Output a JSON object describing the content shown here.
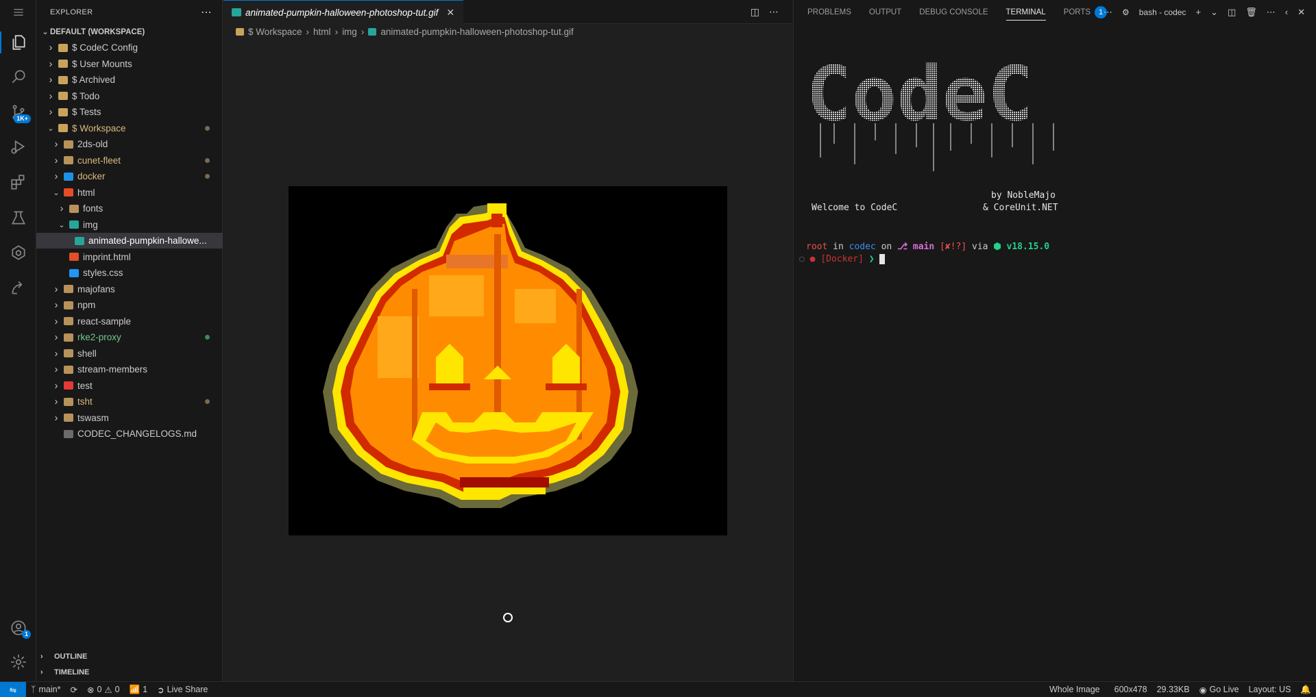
{
  "explorer": {
    "title": "EXPLORER",
    "workspace": "DEFAULT (WORKSPACE)",
    "items": [
      {
        "label": "$ CodeC Config",
        "color": "#cccccc"
      },
      {
        "label": "$ User Mounts",
        "color": "#cccccc"
      },
      {
        "label": "$ Archived",
        "color": "#cccccc"
      },
      {
        "label": "$ Todo",
        "color": "#cccccc"
      },
      {
        "label": "$ Tests",
        "color": "#cccccc"
      },
      {
        "label": "$ Workspace",
        "color": "#d7ba7d"
      },
      {
        "label": "2ds-old",
        "color": "#cccccc"
      },
      {
        "label": "cunet-fleet",
        "color": "#d7ba7d"
      },
      {
        "label": "docker",
        "color": "#d7ba7d"
      },
      {
        "label": "html",
        "color": "#cccccc"
      },
      {
        "label": "fonts",
        "color": "#cccccc"
      },
      {
        "label": "img",
        "color": "#cccccc"
      },
      {
        "label": "animated-pumpkin-hallowe...",
        "color": "#ffffff"
      },
      {
        "label": "imprint.html",
        "color": "#cccccc"
      },
      {
        "label": "styles.css",
        "color": "#cccccc"
      },
      {
        "label": "majofans",
        "color": "#cccccc"
      },
      {
        "label": "npm",
        "color": "#cccccc"
      },
      {
        "label": "react-sample",
        "color": "#cccccc"
      },
      {
        "label": "rke2-proxy",
        "color": "#73c991"
      },
      {
        "label": "shell",
        "color": "#cccccc"
      },
      {
        "label": "stream-members",
        "color": "#cccccc"
      },
      {
        "label": "test",
        "color": "#cccccc"
      },
      {
        "label": "tsht",
        "color": "#d7ba7d"
      },
      {
        "label": "tswasm",
        "color": "#cccccc"
      },
      {
        "label": "CODEC_CHANGELOGS.md",
        "color": "#cccccc"
      }
    ],
    "outline": "OUTLINE",
    "timeline": "TIMELINE"
  },
  "activity_badges": {
    "source_control": "1K+",
    "accounts": "1"
  },
  "editor": {
    "tab_label": "animated-pumpkin-halloween-photoshop-tut.gif",
    "breadcrumb": [
      "$ Workspace",
      "html",
      "img",
      "animated-pumpkin-halloween-photoshop-tut.gif"
    ]
  },
  "panel": {
    "tabs": [
      "PROBLEMS",
      "OUTPUT",
      "DEBUG CONSOLE",
      "TERMINAL",
      "PORTS"
    ],
    "ports_badge": "1",
    "terminal_name": "bash - codec",
    "logo_text": "CodeC",
    "welcome": "Welcome to CodeC",
    "by_line1": "by NobleMajo",
    "by_line2": "& CoreUnit.NET",
    "prompt": {
      "user": "root",
      "in": " in ",
      "host": "codec",
      "on": " on ",
      "branch": "⎇ main",
      "status": " [✘!?]",
      "via": " via ",
      "node": "⬢ v18.15.0"
    },
    "prompt2": "[Docker]",
    "prompt_arrow": "❯"
  },
  "statusbar": {
    "branch": "main*",
    "errors": "0",
    "warnings": "0",
    "ports": "1",
    "live_share": "Live Share",
    "whole_image": "Whole Image",
    "dimensions": "600x478",
    "size": "29.33KB",
    "go_live": "Go Live",
    "layout": "Layout: US"
  },
  "colors": {
    "accent": "#0078d4",
    "pumpkin_orange": "#ff8c00",
    "pumpkin_red": "#d12a00",
    "pumpkin_yellow": "#ffe600"
  }
}
